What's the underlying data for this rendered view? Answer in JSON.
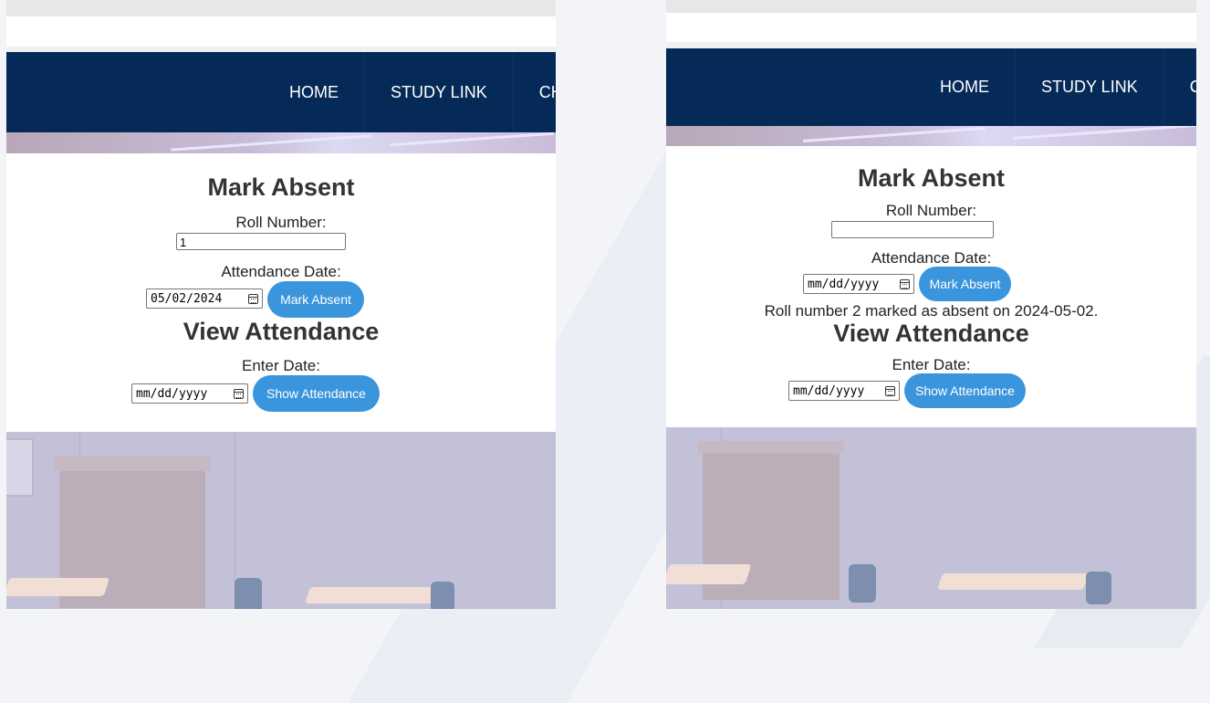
{
  "colors": {
    "navbar_bg": "#062a57",
    "button_bg": "#3b95dc",
    "page_bg": "#f3f4f8"
  },
  "nav": {
    "items": [
      "HOME",
      "STUDY LINK",
      "CH"
    ]
  },
  "left": {
    "mark_title": "Mark Absent",
    "roll_label": "Roll Number:",
    "roll_value": "1",
    "date_label": "Attendance Date:",
    "date_value": "05/02/2024",
    "mark_button": "Mark Absent",
    "view_title": "View Attendance",
    "enter_date_label": "Enter Date:",
    "enter_date_value": "mm/dd/yyyy",
    "show_button": "Show Attendance"
  },
  "right": {
    "mark_title": "Mark Absent",
    "roll_label": "Roll Number:",
    "roll_value": "",
    "date_label": "Attendance Date:",
    "date_value": "mm/dd/yyyy",
    "mark_button": "Mark Absent",
    "status_message": "Roll number 2 marked as absent on 2024-05-02.",
    "view_title": "View Attendance",
    "enter_date_label": "Enter Date:",
    "enter_date_value": "mm/dd/yyyy",
    "show_button": "Show Attendance"
  },
  "icons": {
    "date_picker": "calendar-icon"
  }
}
